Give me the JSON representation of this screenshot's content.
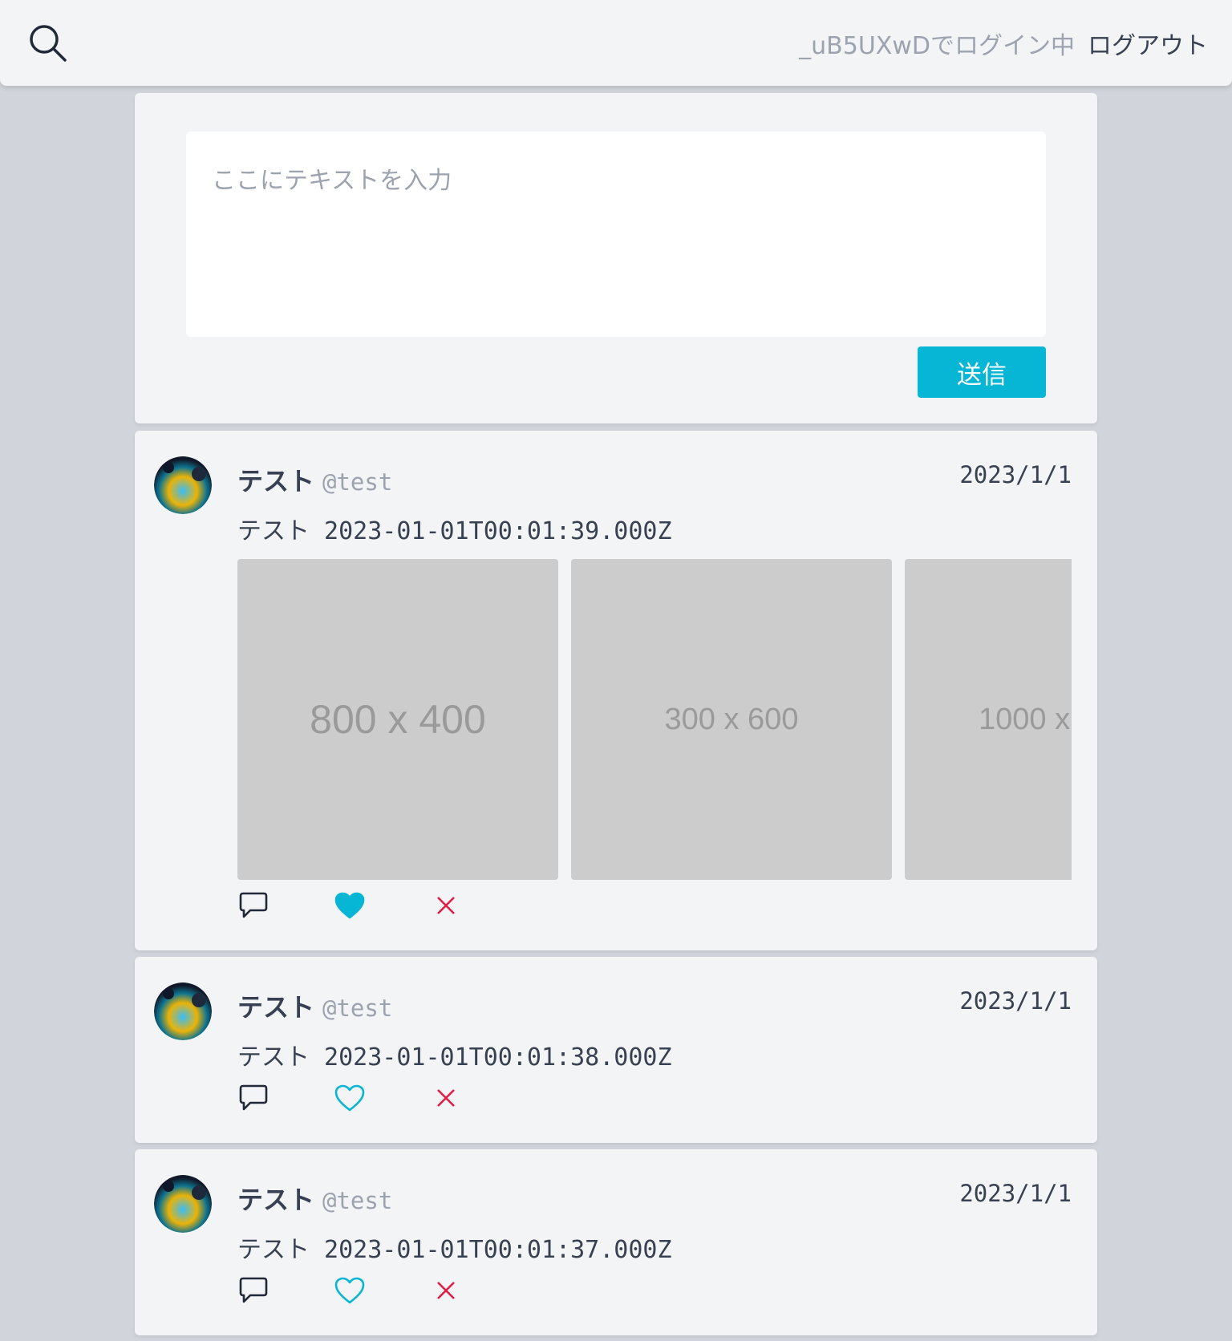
{
  "header": {
    "login_status": "_uB5UXwDでログイン中",
    "logout_label": "ログアウト",
    "search_icon": "search-icon"
  },
  "composer": {
    "placeholder": "ここにテキストを入力",
    "value": "",
    "send_label": "送信"
  },
  "colors": {
    "accent": "#06b6d4",
    "delete": "#e11d48",
    "background": "#d1d5db",
    "card": "#f3f4f6",
    "placeholder_image": "#cccccc"
  },
  "posts": [
    {
      "display_name": "テスト",
      "handle": "@test",
      "date": "2023/1/1",
      "text": "テスト 2023-01-01T00:01:39.000Z",
      "liked": true,
      "media": [
        "800 x 400",
        "300 x 600",
        "1000 x"
      ],
      "icons": [
        "reply-icon",
        "heart-filled-icon",
        "delete-icon"
      ]
    },
    {
      "display_name": "テスト",
      "handle": "@test",
      "date": "2023/1/1",
      "text": "テスト 2023-01-01T00:01:38.000Z",
      "liked": false,
      "media": [],
      "icons": [
        "reply-icon",
        "heart-outline-icon",
        "delete-icon"
      ]
    },
    {
      "display_name": "テスト",
      "handle": "@test",
      "date": "2023/1/1",
      "text": "テスト 2023-01-01T00:01:37.000Z",
      "liked": false,
      "media": [],
      "icons": [
        "reply-icon",
        "heart-outline-icon",
        "delete-icon"
      ]
    }
  ]
}
